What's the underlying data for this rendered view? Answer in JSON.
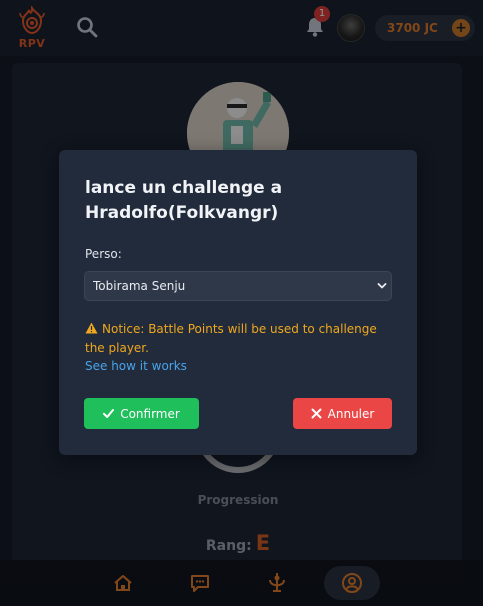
{
  "header": {
    "logo_text": "RPV",
    "notification_count": "1",
    "coins": "3700 JC",
    "add_coins_symbol": "+"
  },
  "profile": {
    "progress_label": "Progression",
    "rank_label": "Rang:",
    "rank_value": "E"
  },
  "modal": {
    "title_line1": "lance un challenge a",
    "title_line2": "Hradolfo(Folkvangr)",
    "perso_label": "Perso:",
    "perso_selected": "Tobirama Senju",
    "notice_text": "Notice: Battle Points will be used to challenge the player.",
    "how_link": "See how it works",
    "confirm_label": "Confirmer",
    "cancel_label": "Annuler"
  },
  "colors": {
    "accent_orange": "#e07a2a",
    "rank_orange": "#d55d27",
    "confirm_green": "#1fbf5c",
    "cancel_red": "#ea4646",
    "notice_amber": "#f0a81e",
    "link_blue": "#4aa3ea",
    "badge_red": "#d93c3c"
  },
  "icons": {
    "logo": "flame-eye-logo",
    "search": "search-icon",
    "notifications": "bell-icon",
    "notice": "warning-icon",
    "confirm": "check-icon",
    "cancel": "close-icon",
    "nav": [
      "home-icon",
      "chat-icon",
      "guild-icon",
      "profile-icon"
    ]
  }
}
